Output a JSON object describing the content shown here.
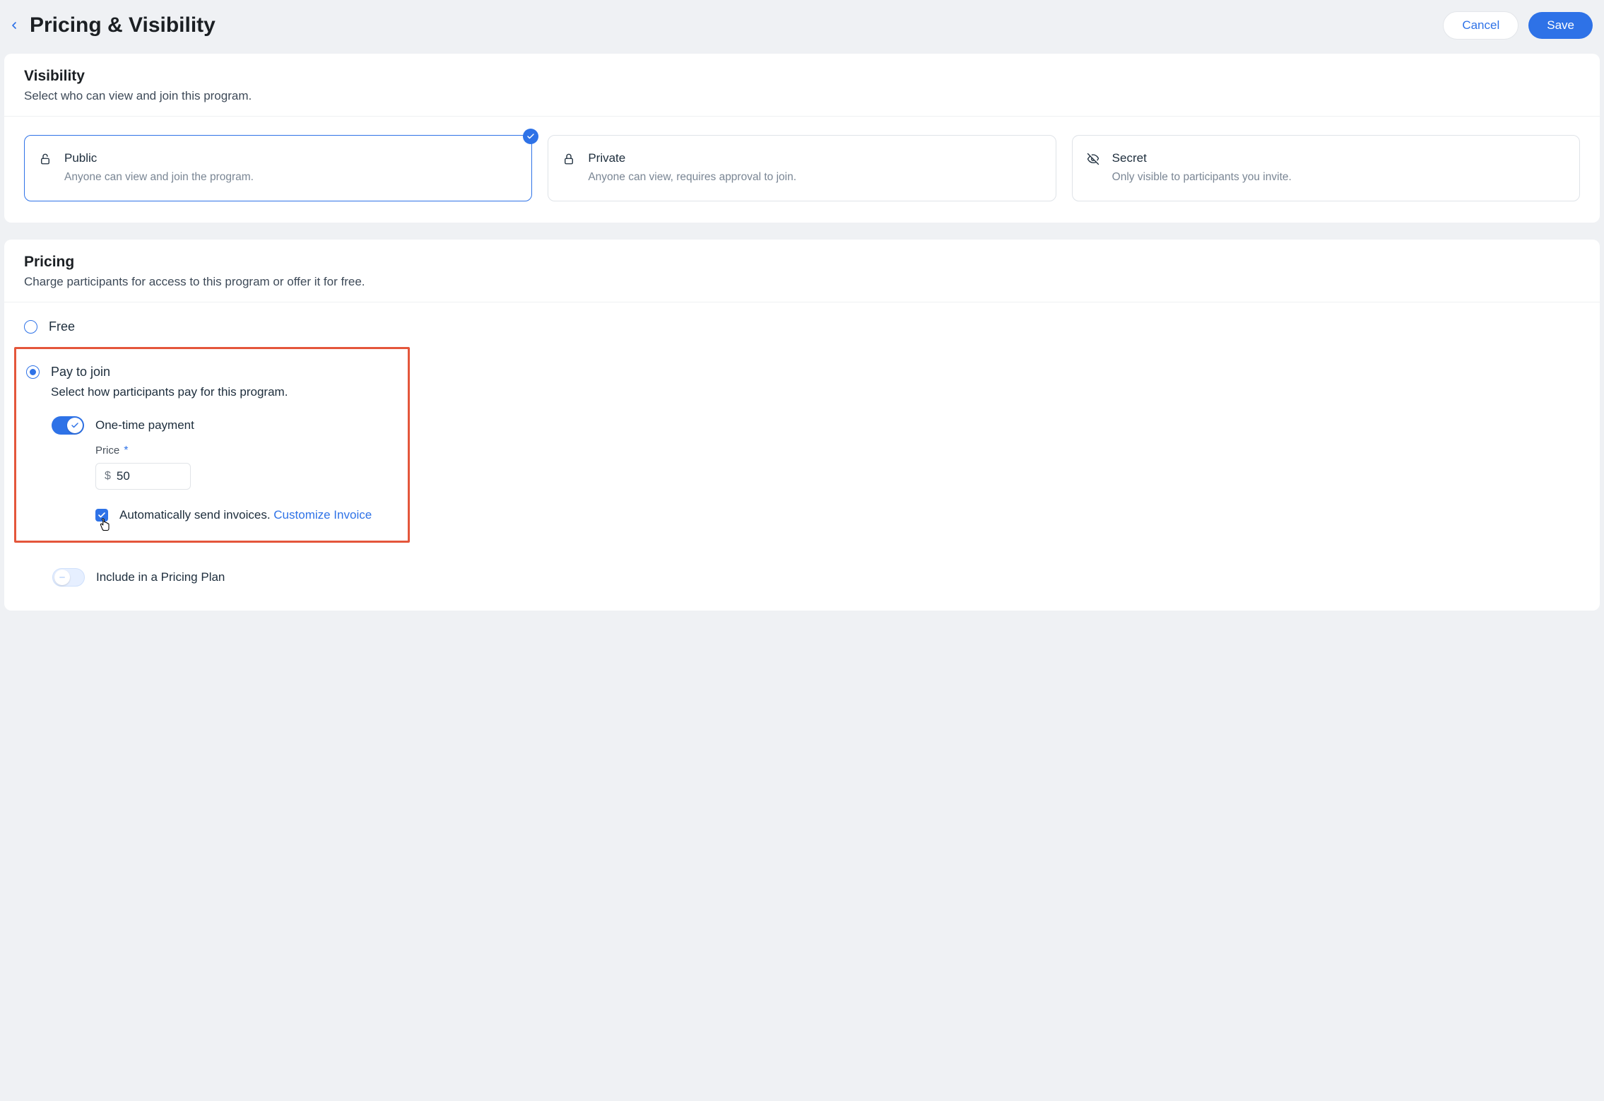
{
  "header": {
    "title": "Pricing & Visibility",
    "cancel": "Cancel",
    "save": "Save"
  },
  "visibility": {
    "title": "Visibility",
    "subtitle": "Select who can view and join this program.",
    "options": [
      {
        "title": "Public",
        "desc": "Anyone can view and join the program."
      },
      {
        "title": "Private",
        "desc": "Anyone can view, requires approval to join."
      },
      {
        "title": "Secret",
        "desc": "Only visible to participants you invite."
      }
    ]
  },
  "pricing": {
    "title": "Pricing",
    "subtitle": "Charge participants for access to this program or offer it for free.",
    "free_label": "Free",
    "pay_label": "Pay to join",
    "pay_sub": "Select how participants pay for this program.",
    "one_time_label": "One-time payment",
    "price_label": "Price",
    "currency_symbol": "$",
    "price_value": "50",
    "invoice_text": "Automatically send invoices. ",
    "invoice_link": "Customize Invoice",
    "include_plan_label": "Include in a Pricing Plan"
  }
}
